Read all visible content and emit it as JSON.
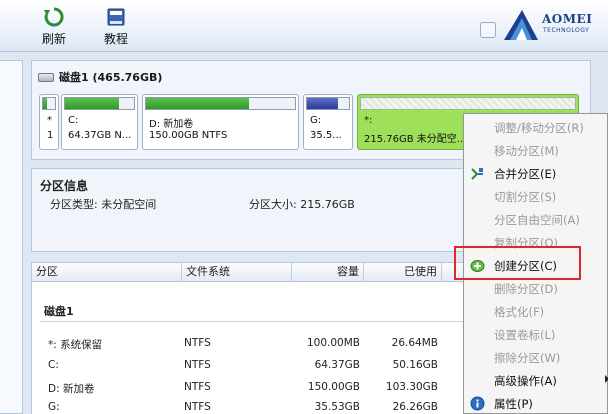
{
  "toolbar": {
    "refresh_label": "刷新",
    "tutorial_label": "教程",
    "logo_word": "AOMEI",
    "logo_sub": "TECHNOLOGY",
    "logo_color": "#1d3f8c"
  },
  "disk": {
    "title": "磁盘1 (465.76GB)",
    "partitions": [
      {
        "name": "*",
        "size": "1",
        "used_fraction": 0.3,
        "color": "#2f9a2a"
      },
      {
        "name": "C:",
        "size": "64.37GB N...",
        "used_fraction": 0.78,
        "color": "#2f9a2a"
      },
      {
        "name": "D: 新加卷",
        "size": "150.00GB NTFS",
        "used_fraction": 0.69,
        "color": "#2f9a2a"
      },
      {
        "name": "G:",
        "size": "35.5...",
        "used_fraction": 0.74,
        "color": "#2d3a99"
      },
      {
        "name": "*:",
        "size": "215.76GB 未分配空...",
        "used_fraction": 0,
        "color": "#9ee05a"
      }
    ]
  },
  "partition_info": {
    "title": "分区信息",
    "type_text": "分区类型: 未分配空间",
    "size_text": "分区大小: 215.76GB"
  },
  "table": {
    "headers": [
      "分区",
      "文件系统",
      "容量",
      "已使用"
    ],
    "group_label": "磁盘1",
    "rows": [
      {
        "name": "*: 系统保留",
        "fs": "NTFS",
        "capacity": "100.00MB",
        "used": "26.64MB"
      },
      {
        "name": "C:",
        "fs": "NTFS",
        "capacity": "64.37GB",
        "used": "50.16GB"
      },
      {
        "name": "D: 新加卷",
        "fs": "NTFS",
        "capacity": "150.00GB",
        "used": "103.30GB"
      },
      {
        "name": "G:",
        "fs": "NTFS",
        "capacity": "35.53GB",
        "used": "26.26GB"
      }
    ]
  },
  "context_menu": {
    "items": [
      {
        "label": "调整/移动分区(R)",
        "enabled": false,
        "icon": "resize-icon"
      },
      {
        "label": "移动分区(M)",
        "enabled": false,
        "icon": "move-icon"
      },
      {
        "label": "合并分区(E)",
        "enabled": true,
        "icon": "merge-icon"
      },
      {
        "label": "切割分区(S)",
        "enabled": false,
        "icon": "split-icon"
      },
      {
        "label": "分区自由空间(A)",
        "enabled": false,
        "icon": "free-space-icon"
      },
      {
        "label": "复制分区(O)",
        "enabled": false,
        "icon": "copy-icon"
      },
      {
        "label": "创建分区(C)",
        "enabled": true,
        "icon": "create-partition-icon"
      },
      {
        "label": "删除分区(D)",
        "enabled": false,
        "icon": "delete-icon"
      },
      {
        "label": "格式化(F)",
        "enabled": false,
        "icon": "format-icon"
      },
      {
        "label": "设置卷标(L)",
        "enabled": false,
        "icon": "label-icon"
      },
      {
        "label": "擦除分区(W)",
        "enabled": false,
        "icon": "wipe-icon"
      },
      {
        "label": "高级操作(A)",
        "enabled": true,
        "icon": "advanced-icon",
        "submenu": true
      },
      {
        "label": "属性(P)",
        "enabled": true,
        "icon": "properties-icon"
      }
    ],
    "highlight_color": "#e0282b"
  }
}
